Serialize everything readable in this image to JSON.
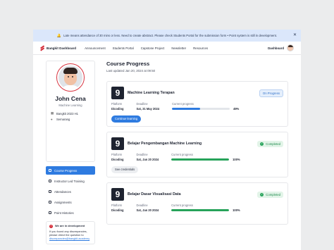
{
  "announcement": {
    "text": "Late means attendance of 30 mins or less. Need to create abstract. Please check Students Portal for the submission form • Point system is still in development.",
    "icon": "bell-icon",
    "close_icon": "close-icon"
  },
  "nav": {
    "brand": "Bangkit Dashboard",
    "links": [
      "Announcement",
      "Students Portal",
      "Capstone Project",
      "Newsletter",
      "Resources"
    ],
    "right_label": "Dashboard"
  },
  "profile": {
    "name": "John Cena",
    "role": "Machine Learning",
    "cohort": "Bangkit 2023 H1",
    "location": "Semarang"
  },
  "menu": [
    {
      "label": "Course Progress",
      "active": true
    },
    {
      "label": "Instructor Led Training",
      "active": false
    },
    {
      "label": "Attendances",
      "active": false
    },
    {
      "label": "Assignments",
      "active": false
    },
    {
      "label": "Point Histories",
      "active": false
    }
  ],
  "dev_notice": {
    "title": "We are in development",
    "body": "If you found any discrepancies, please direct the question to",
    "email": "discrepancies@bangkit.academy"
  },
  "main": {
    "title": "Course Progress",
    "updated": "Last updated Jan 20, 2024 at 09:50"
  },
  "labels": {
    "platform": "Platform",
    "deadline": "Deadline",
    "current_progress": "Current progress"
  },
  "courses": [
    {
      "title": "Machine Learning Terapan",
      "logo": "9",
      "status": "On Progress",
      "platform": "Dicoding",
      "deadline": "Sat, 31 May 2024",
      "progress_text": "49%",
      "progress": 0.49,
      "bar_color": "#2e7be0",
      "button": "Continue learning"
    },
    {
      "title": "Belajar Pengembangan Machine Learning",
      "logo": "9",
      "status": "Completed",
      "platform": "Dicoding",
      "deadline": "Sat, Jan 20 2024",
      "progress_text": "100%",
      "progress": 1.0,
      "bar_color": "#27a35a",
      "button": "See credentials"
    },
    {
      "title": "Belajar Dasar Visualisasi Data",
      "logo": "9",
      "status": "Completed",
      "platform": "Dicoding",
      "deadline": "Sat, Jan 20 2024",
      "progress_text": "100%",
      "progress": 1.0,
      "bar_color": "#27a35a"
    }
  ],
  "colors": {
    "accent": "#2e7be0",
    "brand": "#d42a36",
    "success": "#27a35a",
    "announcement_bg": "#dbe7fb"
  }
}
